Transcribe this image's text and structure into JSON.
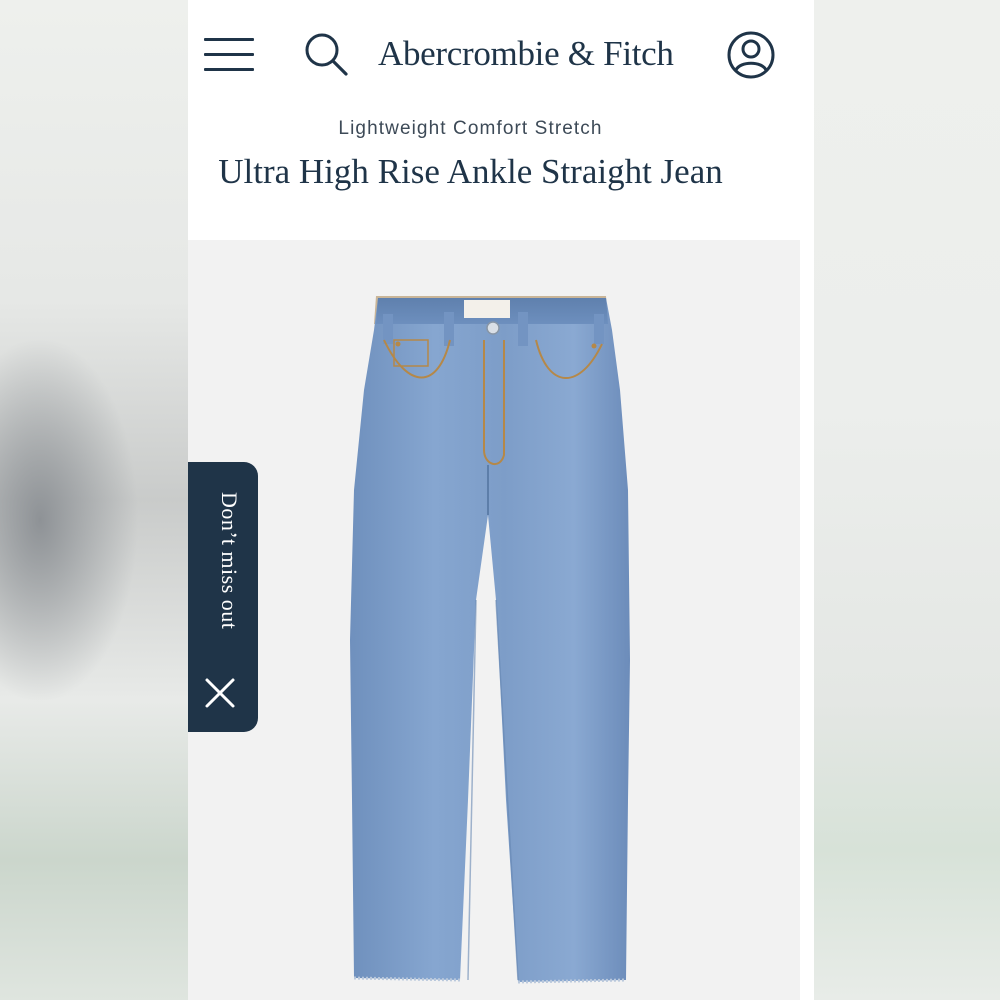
{
  "header": {
    "brand": "Abercrombie & Fitch",
    "menu_icon": "hamburger-menu-icon",
    "search_icon": "search-icon",
    "account_icon": "user-account-icon"
  },
  "product": {
    "subtitle": "Lightweight Comfort Stretch",
    "title": "Ultra High Rise Ankle Straight Jean",
    "image_alt": "light wash denim jeans"
  },
  "promo": {
    "label": "Don’t miss out",
    "close_icon": "close-icon"
  },
  "colors": {
    "brand_navy": "#1f3448",
    "denim": "#7b9cc8",
    "image_bg": "#f2f2f2"
  }
}
